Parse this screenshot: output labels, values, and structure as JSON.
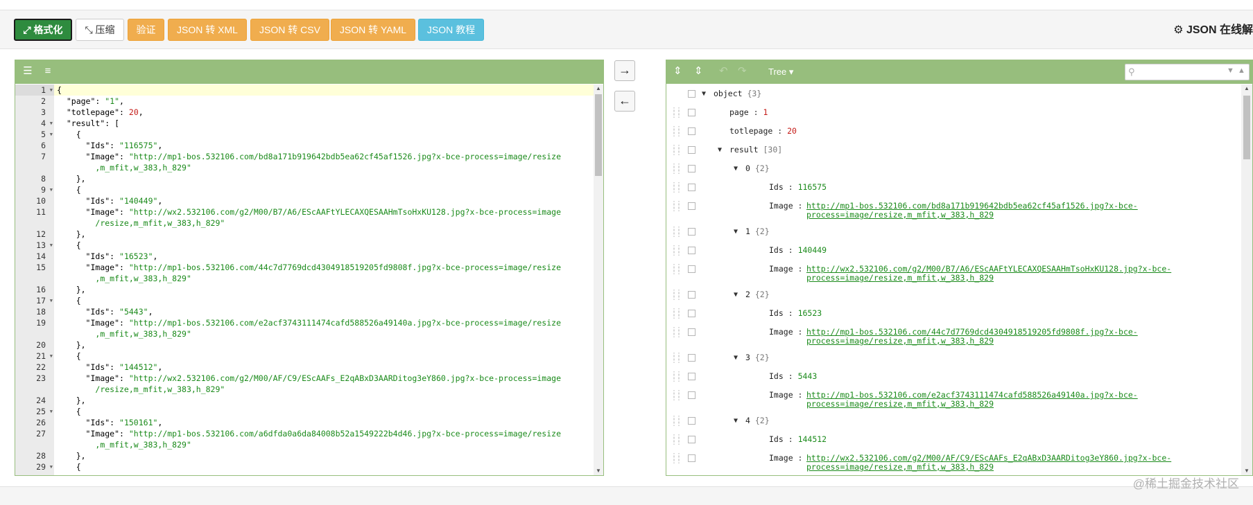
{
  "toolbar": {
    "format_label": "⤢ 格式化",
    "compress_label": "⤡ 压缩",
    "validate_label": "验证",
    "to_xml_label": "JSON 转 XML",
    "to_csv_label": "JSON 转 CSV",
    "to_yaml_label": "JSON 转 YAML",
    "tutorial_label": "JSON 教程",
    "site_title": "⚙ JSON 在线解"
  },
  "editor": {
    "line_numbers": [
      "1",
      "2",
      "3",
      "4",
      "5",
      "6",
      "7",
      "",
      "8",
      "9",
      "10",
      "11",
      "",
      "12",
      "13",
      "14",
      "15",
      "",
      "16",
      "17",
      "18",
      "19",
      "",
      "20",
      "21",
      "22",
      "23",
      "",
      "24",
      "25",
      "26",
      "27",
      "",
      "28",
      "29"
    ],
    "lines": [
      "{",
      "  \"page\": \"1\",",
      "  \"totlepage\": 20,",
      "  \"result\": [",
      "    {",
      "      \"Ids\": \"116575\",",
      "      \"Image\": \"http://mp1-bos.532106.com/bd8a171b919642bdb5ea62cf45af1526.jpg?x-bce-process=image/resize",
      "        ,m_mfit,w_383,h_829\"",
      "    },",
      "    {",
      "      \"Ids\": \"140449\",",
      "      \"Image\": \"http://wx2.532106.com/g2/M00/B7/A6/EScAAFtYLECAXQESAAHmTsoHxKU128.jpg?x-bce-process=image",
      "        /resize,m_mfit,w_383,h_829\"",
      "    },",
      "    {",
      "      \"Ids\": \"16523\",",
      "      \"Image\": \"http://mp1-bos.532106.com/44c7d7769dcd4304918519205fd9808f.jpg?x-bce-process=image/resize",
      "        ,m_mfit,w_383,h_829\"",
      "    },",
      "    {",
      "      \"Ids\": \"5443\",",
      "      \"Image\": \"http://mp1-bos.532106.com/e2acf3743111474cafd588526a49140a.jpg?x-bce-process=image/resize",
      "        ,m_mfit,w_383,h_829\"",
      "    },",
      "    {",
      "      \"Ids\": \"144512\",",
      "      \"Image\": \"http://wx2.532106.com/g2/M00/AF/C9/EScAAFs_E2qABxD3AARDitog3eY860.jpg?x-bce-process=image",
      "        /resize,m_mfit,w_383,h_829\"",
      "    },",
      "    {",
      "      \"Ids\": \"150161\",",
      "      \"Image\": \"http://mp1-bos.532106.com/a6dfda0a6da84008b52a1549222b4d46.jpg?x-bce-process=image/resize",
      "        ,m_mfit,w_383,h_829\"",
      "    },",
      "    {"
    ]
  },
  "tree": {
    "mode_label": "Tree ▾",
    "root_key": "object",
    "root_meta": "{3}",
    "page_key": "page",
    "page_val": "1",
    "totle_key": "totlepage",
    "totle_val": "20",
    "result_key": "result",
    "result_meta": "[30]",
    "items": [
      {
        "index": "0",
        "meta": "{2}",
        "ids": "116575",
        "image": "http://mp1-bos.532106.com/bd8a171b919642bdb5ea62cf45af1526.jpg?x-bce-\nprocess=image/resize,m_mfit,w_383,h_829"
      },
      {
        "index": "1",
        "meta": "{2}",
        "ids": "140449",
        "image": "http://wx2.532106.com/g2/M00/B7/A6/EScAAFtYLECAXQESAAHmTsoHxKU128.jpg?x-bce-\nprocess=image/resize,m_mfit,w_383,h_829"
      },
      {
        "index": "2",
        "meta": "{2}",
        "ids": "16523",
        "image": "http://mp1-bos.532106.com/44c7d7769dcd4304918519205fd9808f.jpg?x-bce-\nprocess=image/resize,m_mfit,w_383,h_829"
      },
      {
        "index": "3",
        "meta": "{2}",
        "ids": "5443",
        "image": "http://mp1-bos.532106.com/e2acf3743111474cafd588526a49140a.jpg?x-bce-\nprocess=image/resize,m_mfit,w_383,h_829"
      },
      {
        "index": "4",
        "meta": "{2}",
        "ids": "144512",
        "image": "http://wx2.532106.com/g2/M00/AF/C9/EScAAFs_E2qABxD3AARDitog3eY860.jpg?x-bce-\nprocess=image/resize,m_mfit,w_383,h_829"
      }
    ],
    "ids_key": "Ids",
    "image_key": "Image"
  },
  "watermark": "@稀土掘金技术社区",
  "colors": {
    "panel_header": "#97be7d",
    "format_button": "#2e8b3e",
    "orange_button": "#f0ad4e",
    "blue_button": "#5bc0de",
    "string_value": "#1a8a1a",
    "number_value": "#c41a16"
  }
}
